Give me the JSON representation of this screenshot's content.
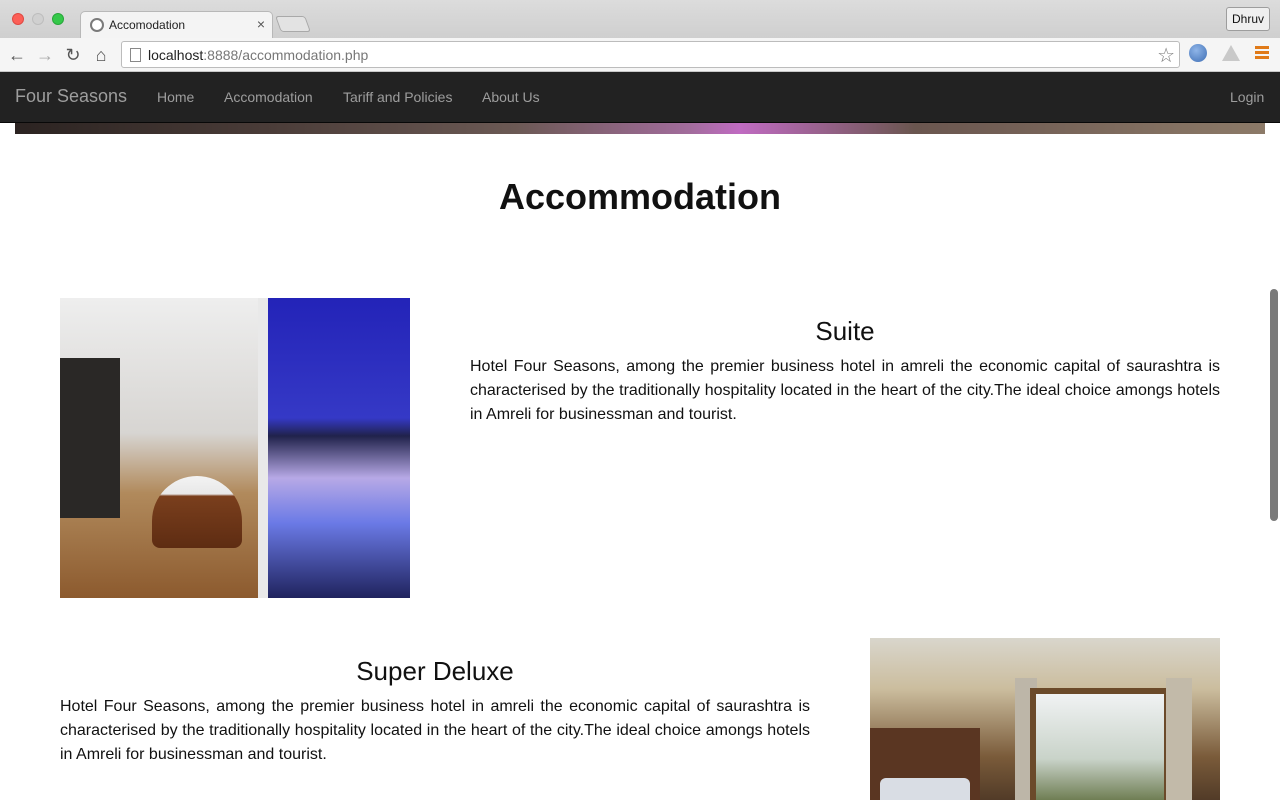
{
  "browser": {
    "tab_title": "Accomodation",
    "tab_close": "×",
    "profile_name": "Dhruv",
    "url_host": "localhost",
    "url_rest": ":8888/accommodation.php",
    "back_glyph": "←",
    "forward_glyph": "→",
    "reload_glyph": "↻",
    "home_glyph": "⌂",
    "star_glyph": "☆"
  },
  "navbar": {
    "brand": "Four Seasons",
    "links": [
      "Home",
      "Accomodation",
      "Tariff and Policies",
      "About Us"
    ],
    "login": "Login"
  },
  "page": {
    "heading": "Accommodation",
    "rooms": [
      {
        "title": "Suite",
        "description": "Hotel Four Seasons, among the premier business hotel in amreli the economic capital of saurashtra is characterised by the traditionally hospitality located in the heart of the city.The ideal choice amongs hotels in Amreli for businessman and tourist."
      },
      {
        "title": "Super Deluxe",
        "description": "Hotel Four Seasons, among the premier business hotel in amreli the economic capital of saurashtra is characterised by the traditionally hospitality located in the heart of the city.The ideal choice amongs hotels in Amreli for businessman and tourist."
      }
    ]
  },
  "colors": {
    "navbar_bg": "#222222",
    "nav_text": "#9d9d9d",
    "menu_accent": "#e07a18"
  }
}
